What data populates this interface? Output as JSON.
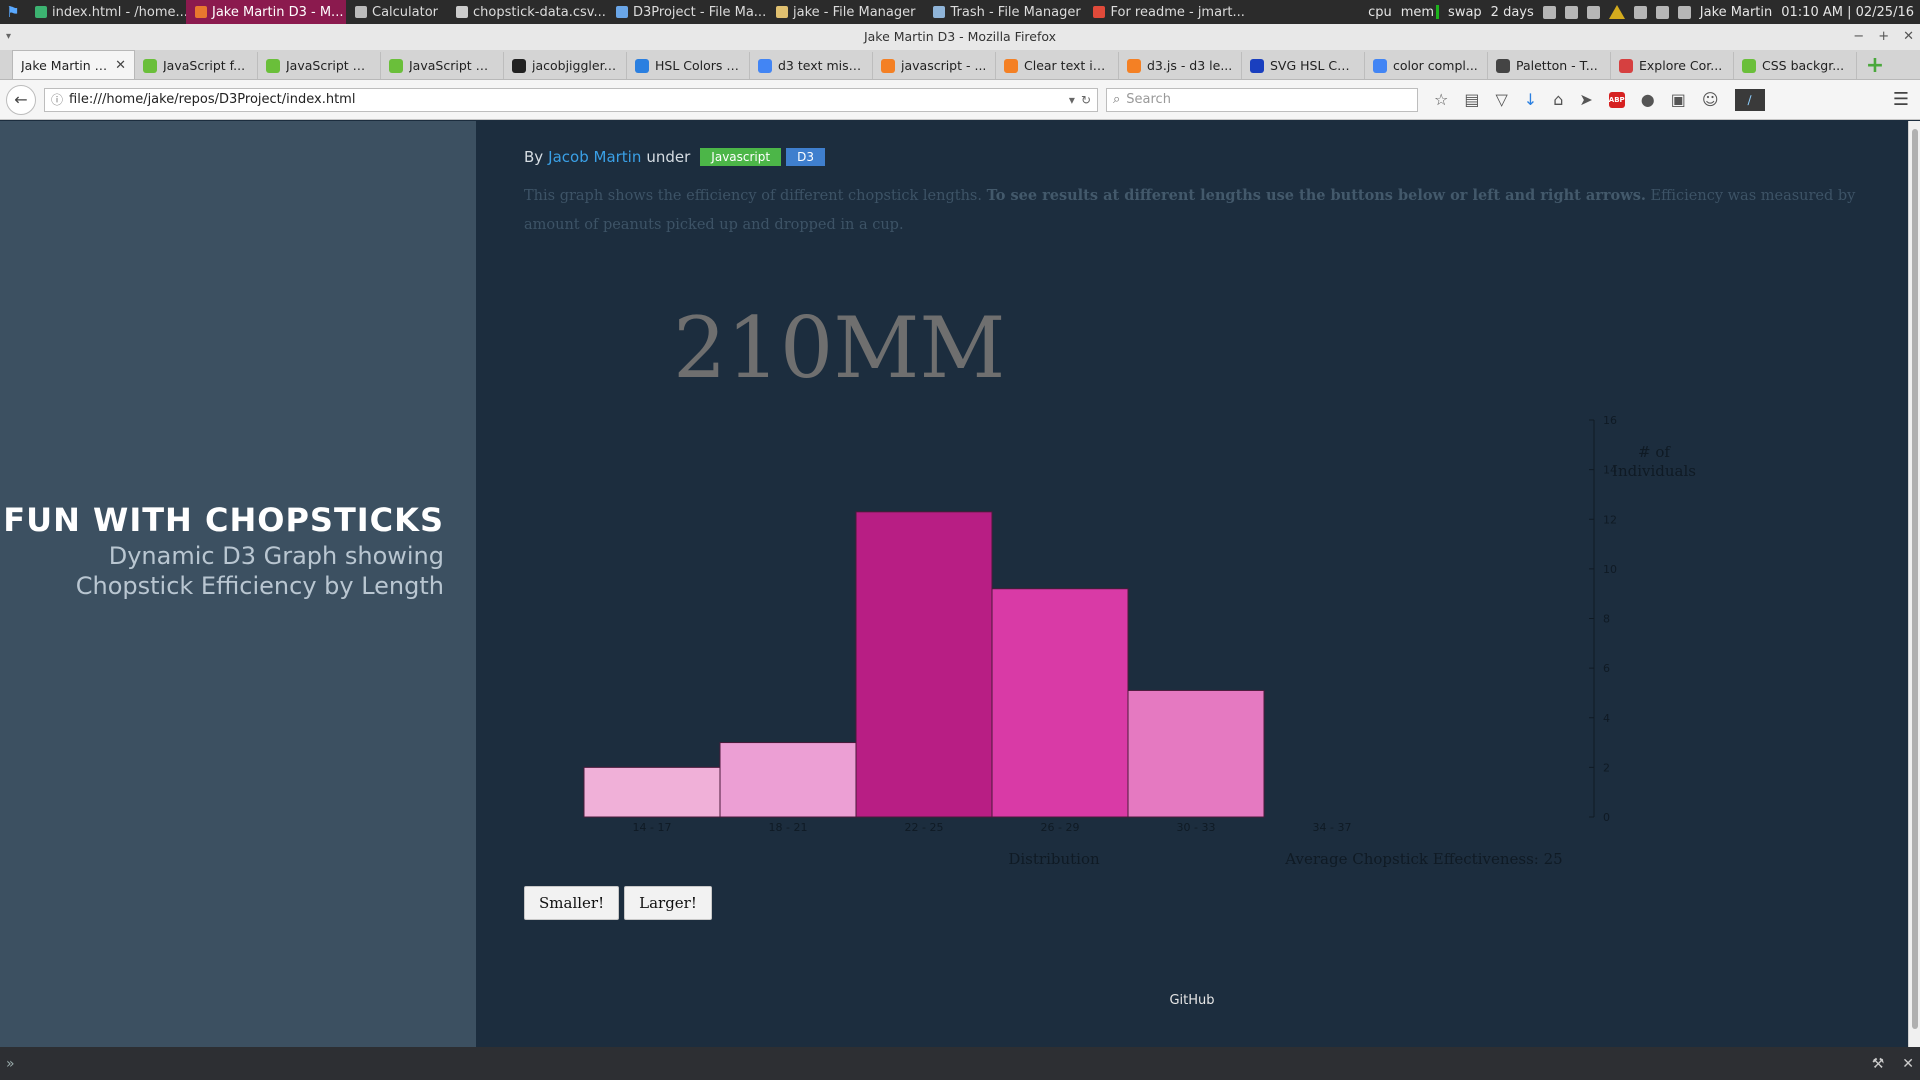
{
  "taskbar": {
    "tasks": [
      {
        "label": "index.html - /home...",
        "icon_color": "#3cb371",
        "active": false
      },
      {
        "label": "Jake Martin D3 - M...",
        "icon_color": "#e8772e",
        "active": true
      },
      {
        "label": "Calculator",
        "icon_color": "#bbbbbb",
        "active": false
      },
      {
        "label": "chopstick-data.csv...",
        "icon_color": "#cccccc",
        "active": false
      },
      {
        "label": "D3Project - File Ma...",
        "icon_color": "#6aa6e8",
        "active": false
      },
      {
        "label": "jake - File Manager",
        "icon_color": "#e0c070",
        "active": false
      },
      {
        "label": "Trash - File Manager",
        "icon_color": "#8fb4d8",
        "active": false
      },
      {
        "label": "For readme - jmart...",
        "icon_color": "#e04a3a",
        "active": false
      }
    ],
    "sys_cpu": "cpu",
    "sys_mem": "mem",
    "sys_swap": "swap",
    "uptime": "2 days",
    "user": "Jake Martin",
    "time": "01:10 AM | 02/25/16"
  },
  "window": {
    "title": "Jake Martin D3 - Mozilla Firefox"
  },
  "tabs": [
    {
      "label": "Jake Martin D3",
      "icon_color": "#ffffff",
      "active": true
    },
    {
      "label": "JavaScript f...",
      "icon_color": "#6abf3a",
      "active": false
    },
    {
      "label": "JavaScript N...",
      "icon_color": "#6abf3a",
      "active": false
    },
    {
      "label": "JavaScript S...",
      "icon_color": "#6abf3a",
      "active": false
    },
    {
      "label": "jacobjiggler....",
      "icon_color": "#222222",
      "active": false
    },
    {
      "label": "HSL Colors -...",
      "icon_color": "#2a7fe0",
      "active": false
    },
    {
      "label": "d3 text miss...",
      "icon_color": "#4285f4",
      "active": false
    },
    {
      "label": "javascript - ...",
      "icon_color": "#f48024",
      "active": false
    },
    {
      "label": "Clear text in...",
      "icon_color": "#f48024",
      "active": false
    },
    {
      "label": "d3.js - d3 le...",
      "icon_color": "#f48024",
      "active": false
    },
    {
      "label": "SVG HSL Col...",
      "icon_color": "#1a3fbf",
      "active": false
    },
    {
      "label": "color compl...",
      "icon_color": "#4285f4",
      "active": false
    },
    {
      "label": "Paletton - T...",
      "icon_color": "#444444",
      "active": false
    },
    {
      "label": "Explore Cor...",
      "icon_color": "#d64040",
      "active": false
    },
    {
      "label": "CSS backgr...",
      "icon_color": "#6abf3a",
      "active": false
    }
  ],
  "navbar": {
    "url": "file:///home/jake/repos/D3Project/index.html",
    "search_placeholder": "Search"
  },
  "sidebar": {
    "title": "FUN WITH CHOPSTICKS",
    "subtitle": "Dynamic D3 Graph showing Chopstick Efficiency by Length"
  },
  "byline": {
    "prefix": "By",
    "author": "Jacob Martin",
    "under": "under",
    "tags": [
      {
        "label": "Javascript",
        "color": "#4cb648"
      },
      {
        "label": "D3",
        "color": "#3f7fce"
      }
    ]
  },
  "intro": {
    "part1": "This graph shows the efficiency of different chopstick lengths.",
    "bold": "To see results at different lengths use the buttons below or left and right arrows.",
    "part2": "Efficiency was measured by amount of peanuts picked up and dropped in a cup."
  },
  "chart_data": {
    "type": "bar",
    "length_label": "210MM",
    "categories": [
      "14 - 17",
      "18 - 21",
      "22 - 25",
      "26 - 29",
      "30 - 33",
      "34 - 37"
    ],
    "values": [
      2,
      3,
      12.3,
      9.2,
      5.1,
      0
    ],
    "colors": [
      "#f0b0d8",
      "#ec9fd4",
      "#b81e84",
      "#d93aa6",
      "#e579c1",
      "#e579c1"
    ],
    "ylim": [
      0,
      16
    ],
    "yticks": [
      0,
      2,
      4,
      6,
      8,
      10,
      12,
      14,
      16
    ],
    "ylabel": "# of Individuals",
    "xlabel": "Distribution",
    "average_label": "Average Chopstick Effectiveness: 25"
  },
  "buttons": {
    "smaller": "Smaller!",
    "larger": "Larger!"
  },
  "footer": {
    "github": "GitHub"
  }
}
